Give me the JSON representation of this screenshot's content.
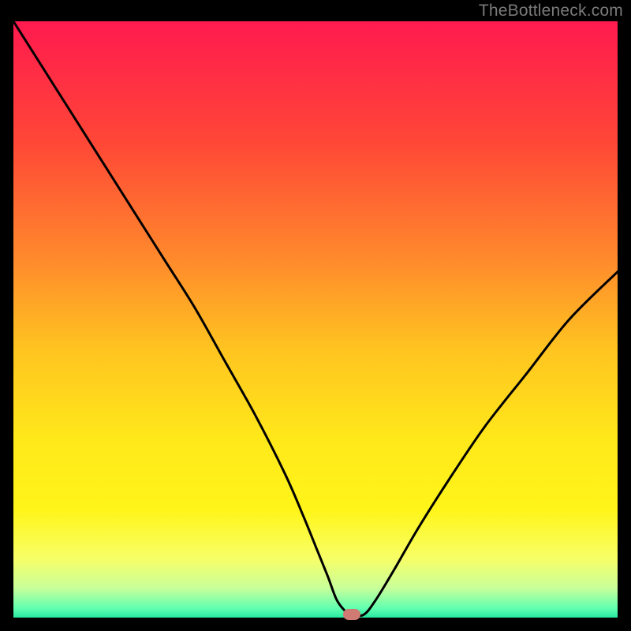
{
  "watermark": {
    "text": "TheBottleneck.com"
  },
  "chart_data": {
    "type": "line",
    "title": "",
    "xlabel": "",
    "ylabel": "",
    "xlim": [
      0,
      100
    ],
    "ylim": [
      0,
      100
    ],
    "grid": false,
    "legend": false,
    "background": {
      "type": "vertical-gradient",
      "stops": [
        {
          "pos": 0.0,
          "color": "#ff1a4f"
        },
        {
          "pos": 0.2,
          "color": "#ff4637"
        },
        {
          "pos": 0.4,
          "color": "#ff8a2c"
        },
        {
          "pos": 0.55,
          "color": "#ffc420"
        },
        {
          "pos": 0.7,
          "color": "#ffe81a"
        },
        {
          "pos": 0.82,
          "color": "#fff51a"
        },
        {
          "pos": 0.9,
          "color": "#f8ff66"
        },
        {
          "pos": 0.95,
          "color": "#c9ff9a"
        },
        {
          "pos": 0.985,
          "color": "#5fffb0"
        },
        {
          "pos": 1.0,
          "color": "#28e8a0"
        }
      ]
    },
    "series": [
      {
        "name": "bottleneck-curve",
        "color": "#000000",
        "x": [
          0,
          5,
          10,
          15,
          20,
          25,
          30,
          35,
          40,
          45,
          48,
          50,
          52,
          53.5,
          55,
          56,
          58,
          60,
          63,
          67,
          72,
          78,
          85,
          92,
          100
        ],
        "y": [
          100,
          92,
          84,
          76,
          68,
          60,
          52,
          43,
          34,
          24,
          17,
          12,
          7,
          3,
          1,
          0.5,
          0.5,
          3,
          8,
          15,
          23,
          32,
          41,
          50,
          58
        ]
      }
    ],
    "marker": {
      "name": "min-point",
      "x": 56,
      "y": 0.5,
      "color": "#cf7a72"
    }
  }
}
